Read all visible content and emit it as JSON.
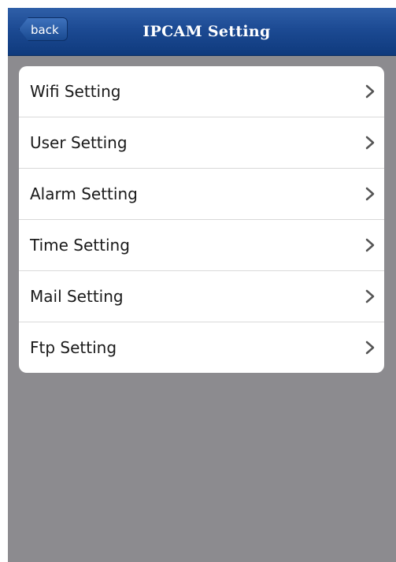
{
  "navbar": {
    "back_label": "back",
    "title": "IPCAM  Setting"
  },
  "settings": {
    "items": [
      {
        "label": "Wifi Setting",
        "icon": "chevron-right-icon"
      },
      {
        "label": "User Setting",
        "icon": "chevron-right-icon"
      },
      {
        "label": "Alarm Setting",
        "icon": "chevron-right-icon"
      },
      {
        "label": "Time Setting",
        "icon": "chevron-right-icon"
      },
      {
        "label": "Mail Setting",
        "icon": "chevron-right-icon"
      },
      {
        "label": "Ftp Setting",
        "icon": "chevron-right-icon"
      }
    ]
  },
  "colors": {
    "navbar": "#1c4a93",
    "background": "#8c8b8f",
    "list_background": "#ffffff",
    "text": "#1a1a1a",
    "chevron": "#555555"
  }
}
